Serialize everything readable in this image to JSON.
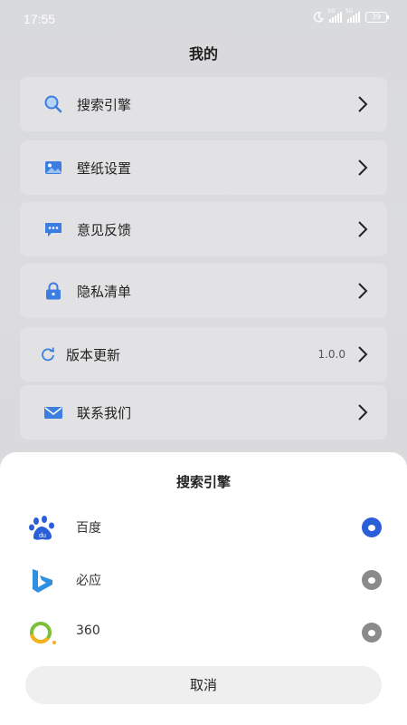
{
  "status_bar": {
    "time": "17:55",
    "battery": "39",
    "signal1": "5G",
    "signal2": "5G"
  },
  "page": {
    "title": "我的"
  },
  "menu": [
    {
      "label": "搜索引擎",
      "icon": "search-icon"
    },
    {
      "label": "壁纸设置",
      "icon": "wallpaper-icon"
    },
    {
      "label": "意见反馈",
      "icon": "chat-bubble-icon"
    },
    {
      "label": "隐私清单",
      "icon": "lock-icon"
    },
    {
      "label": "版本更新",
      "icon": "refresh-icon",
      "value": "1.0.0"
    },
    {
      "label": "联系我们",
      "icon": "mail-icon"
    }
  ],
  "engine_sheet": {
    "title": "搜索引擎",
    "options": [
      {
        "name": "百度",
        "icon": "baidu-logo-icon",
        "selected": true
      },
      {
        "name": "必应",
        "icon": "bing-logo-icon",
        "selected": false
      },
      {
        "name": "360",
        "icon": "360-logo-icon",
        "selected": false
      }
    ],
    "cancel_label": "取消"
  },
  "colors": {
    "accent": "#2b5fd9",
    "icon_blue": "#3b7de0",
    "radio_off": "#8a8a8a"
  }
}
